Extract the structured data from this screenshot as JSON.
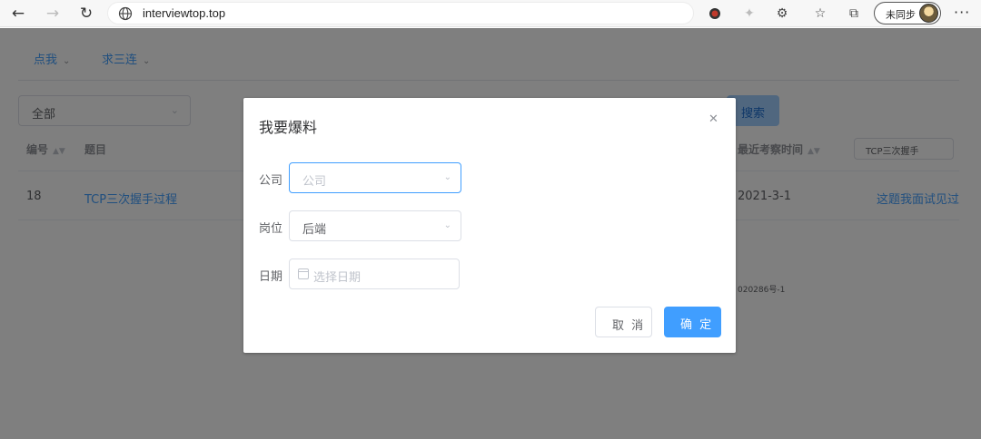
{
  "browser": {
    "url": "interviewtop.top",
    "sync_label": "未同步"
  },
  "page": {
    "menu": [
      {
        "label": "点我"
      },
      {
        "label": "求三连"
      }
    ],
    "filter_select": "全部",
    "search_button": "搜索",
    "table": {
      "headers": {
        "number": "编号",
        "title": "题目",
        "last_time": "最近考察时间"
      },
      "filter_value": "TCP三次握手",
      "rows": [
        {
          "number": "18",
          "title": "TCP三次握手过程",
          "last_time": "2021-3-1",
          "action": "这题我面试见过"
        }
      ]
    },
    "footer": "020286号-1"
  },
  "dialog": {
    "title": "我要爆料",
    "close_icon": "close-icon",
    "fields": {
      "company": {
        "label": "公司",
        "placeholder": "公司"
      },
      "position": {
        "label": "岗位",
        "value": "后端"
      },
      "date": {
        "label": "日期",
        "placeholder": "选择日期"
      }
    },
    "cancel_label": "取 消",
    "confirm_label": "确 定",
    "accent_color": "#409eff"
  }
}
